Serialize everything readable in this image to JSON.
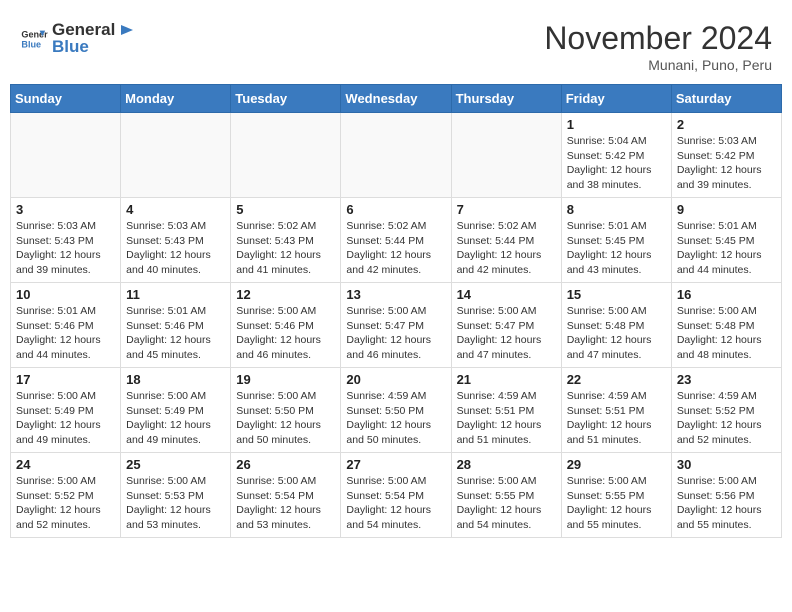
{
  "header": {
    "logo_general": "General",
    "logo_blue": "Blue",
    "month_year": "November 2024",
    "location": "Munani, Puno, Peru"
  },
  "weekdays": [
    "Sunday",
    "Monday",
    "Tuesday",
    "Wednesday",
    "Thursday",
    "Friday",
    "Saturday"
  ],
  "weeks": [
    [
      {
        "day": "",
        "info": ""
      },
      {
        "day": "",
        "info": ""
      },
      {
        "day": "",
        "info": ""
      },
      {
        "day": "",
        "info": ""
      },
      {
        "day": "",
        "info": ""
      },
      {
        "day": "1",
        "info": "Sunrise: 5:04 AM\nSunset: 5:42 PM\nDaylight: 12 hours\nand 38 minutes."
      },
      {
        "day": "2",
        "info": "Sunrise: 5:03 AM\nSunset: 5:42 PM\nDaylight: 12 hours\nand 39 minutes."
      }
    ],
    [
      {
        "day": "3",
        "info": "Sunrise: 5:03 AM\nSunset: 5:43 PM\nDaylight: 12 hours\nand 39 minutes."
      },
      {
        "day": "4",
        "info": "Sunrise: 5:03 AM\nSunset: 5:43 PM\nDaylight: 12 hours\nand 40 minutes."
      },
      {
        "day": "5",
        "info": "Sunrise: 5:02 AM\nSunset: 5:43 PM\nDaylight: 12 hours\nand 41 minutes."
      },
      {
        "day": "6",
        "info": "Sunrise: 5:02 AM\nSunset: 5:44 PM\nDaylight: 12 hours\nand 42 minutes."
      },
      {
        "day": "7",
        "info": "Sunrise: 5:02 AM\nSunset: 5:44 PM\nDaylight: 12 hours\nand 42 minutes."
      },
      {
        "day": "8",
        "info": "Sunrise: 5:01 AM\nSunset: 5:45 PM\nDaylight: 12 hours\nand 43 minutes."
      },
      {
        "day": "9",
        "info": "Sunrise: 5:01 AM\nSunset: 5:45 PM\nDaylight: 12 hours\nand 44 minutes."
      }
    ],
    [
      {
        "day": "10",
        "info": "Sunrise: 5:01 AM\nSunset: 5:46 PM\nDaylight: 12 hours\nand 44 minutes."
      },
      {
        "day": "11",
        "info": "Sunrise: 5:01 AM\nSunset: 5:46 PM\nDaylight: 12 hours\nand 45 minutes."
      },
      {
        "day": "12",
        "info": "Sunrise: 5:00 AM\nSunset: 5:46 PM\nDaylight: 12 hours\nand 46 minutes."
      },
      {
        "day": "13",
        "info": "Sunrise: 5:00 AM\nSunset: 5:47 PM\nDaylight: 12 hours\nand 46 minutes."
      },
      {
        "day": "14",
        "info": "Sunrise: 5:00 AM\nSunset: 5:47 PM\nDaylight: 12 hours\nand 47 minutes."
      },
      {
        "day": "15",
        "info": "Sunrise: 5:00 AM\nSunset: 5:48 PM\nDaylight: 12 hours\nand 47 minutes."
      },
      {
        "day": "16",
        "info": "Sunrise: 5:00 AM\nSunset: 5:48 PM\nDaylight: 12 hours\nand 48 minutes."
      }
    ],
    [
      {
        "day": "17",
        "info": "Sunrise: 5:00 AM\nSunset: 5:49 PM\nDaylight: 12 hours\nand 49 minutes."
      },
      {
        "day": "18",
        "info": "Sunrise: 5:00 AM\nSunset: 5:49 PM\nDaylight: 12 hours\nand 49 minutes."
      },
      {
        "day": "19",
        "info": "Sunrise: 5:00 AM\nSunset: 5:50 PM\nDaylight: 12 hours\nand 50 minutes."
      },
      {
        "day": "20",
        "info": "Sunrise: 4:59 AM\nSunset: 5:50 PM\nDaylight: 12 hours\nand 50 minutes."
      },
      {
        "day": "21",
        "info": "Sunrise: 4:59 AM\nSunset: 5:51 PM\nDaylight: 12 hours\nand 51 minutes."
      },
      {
        "day": "22",
        "info": "Sunrise: 4:59 AM\nSunset: 5:51 PM\nDaylight: 12 hours\nand 51 minutes."
      },
      {
        "day": "23",
        "info": "Sunrise: 4:59 AM\nSunset: 5:52 PM\nDaylight: 12 hours\nand 52 minutes."
      }
    ],
    [
      {
        "day": "24",
        "info": "Sunrise: 5:00 AM\nSunset: 5:52 PM\nDaylight: 12 hours\nand 52 minutes."
      },
      {
        "day": "25",
        "info": "Sunrise: 5:00 AM\nSunset: 5:53 PM\nDaylight: 12 hours\nand 53 minutes."
      },
      {
        "day": "26",
        "info": "Sunrise: 5:00 AM\nSunset: 5:54 PM\nDaylight: 12 hours\nand 53 minutes."
      },
      {
        "day": "27",
        "info": "Sunrise: 5:00 AM\nSunset: 5:54 PM\nDaylight: 12 hours\nand 54 minutes."
      },
      {
        "day": "28",
        "info": "Sunrise: 5:00 AM\nSunset: 5:55 PM\nDaylight: 12 hours\nand 54 minutes."
      },
      {
        "day": "29",
        "info": "Sunrise: 5:00 AM\nSunset: 5:55 PM\nDaylight: 12 hours\nand 55 minutes."
      },
      {
        "day": "30",
        "info": "Sunrise: 5:00 AM\nSunset: 5:56 PM\nDaylight: 12 hours\nand 55 minutes."
      }
    ]
  ]
}
